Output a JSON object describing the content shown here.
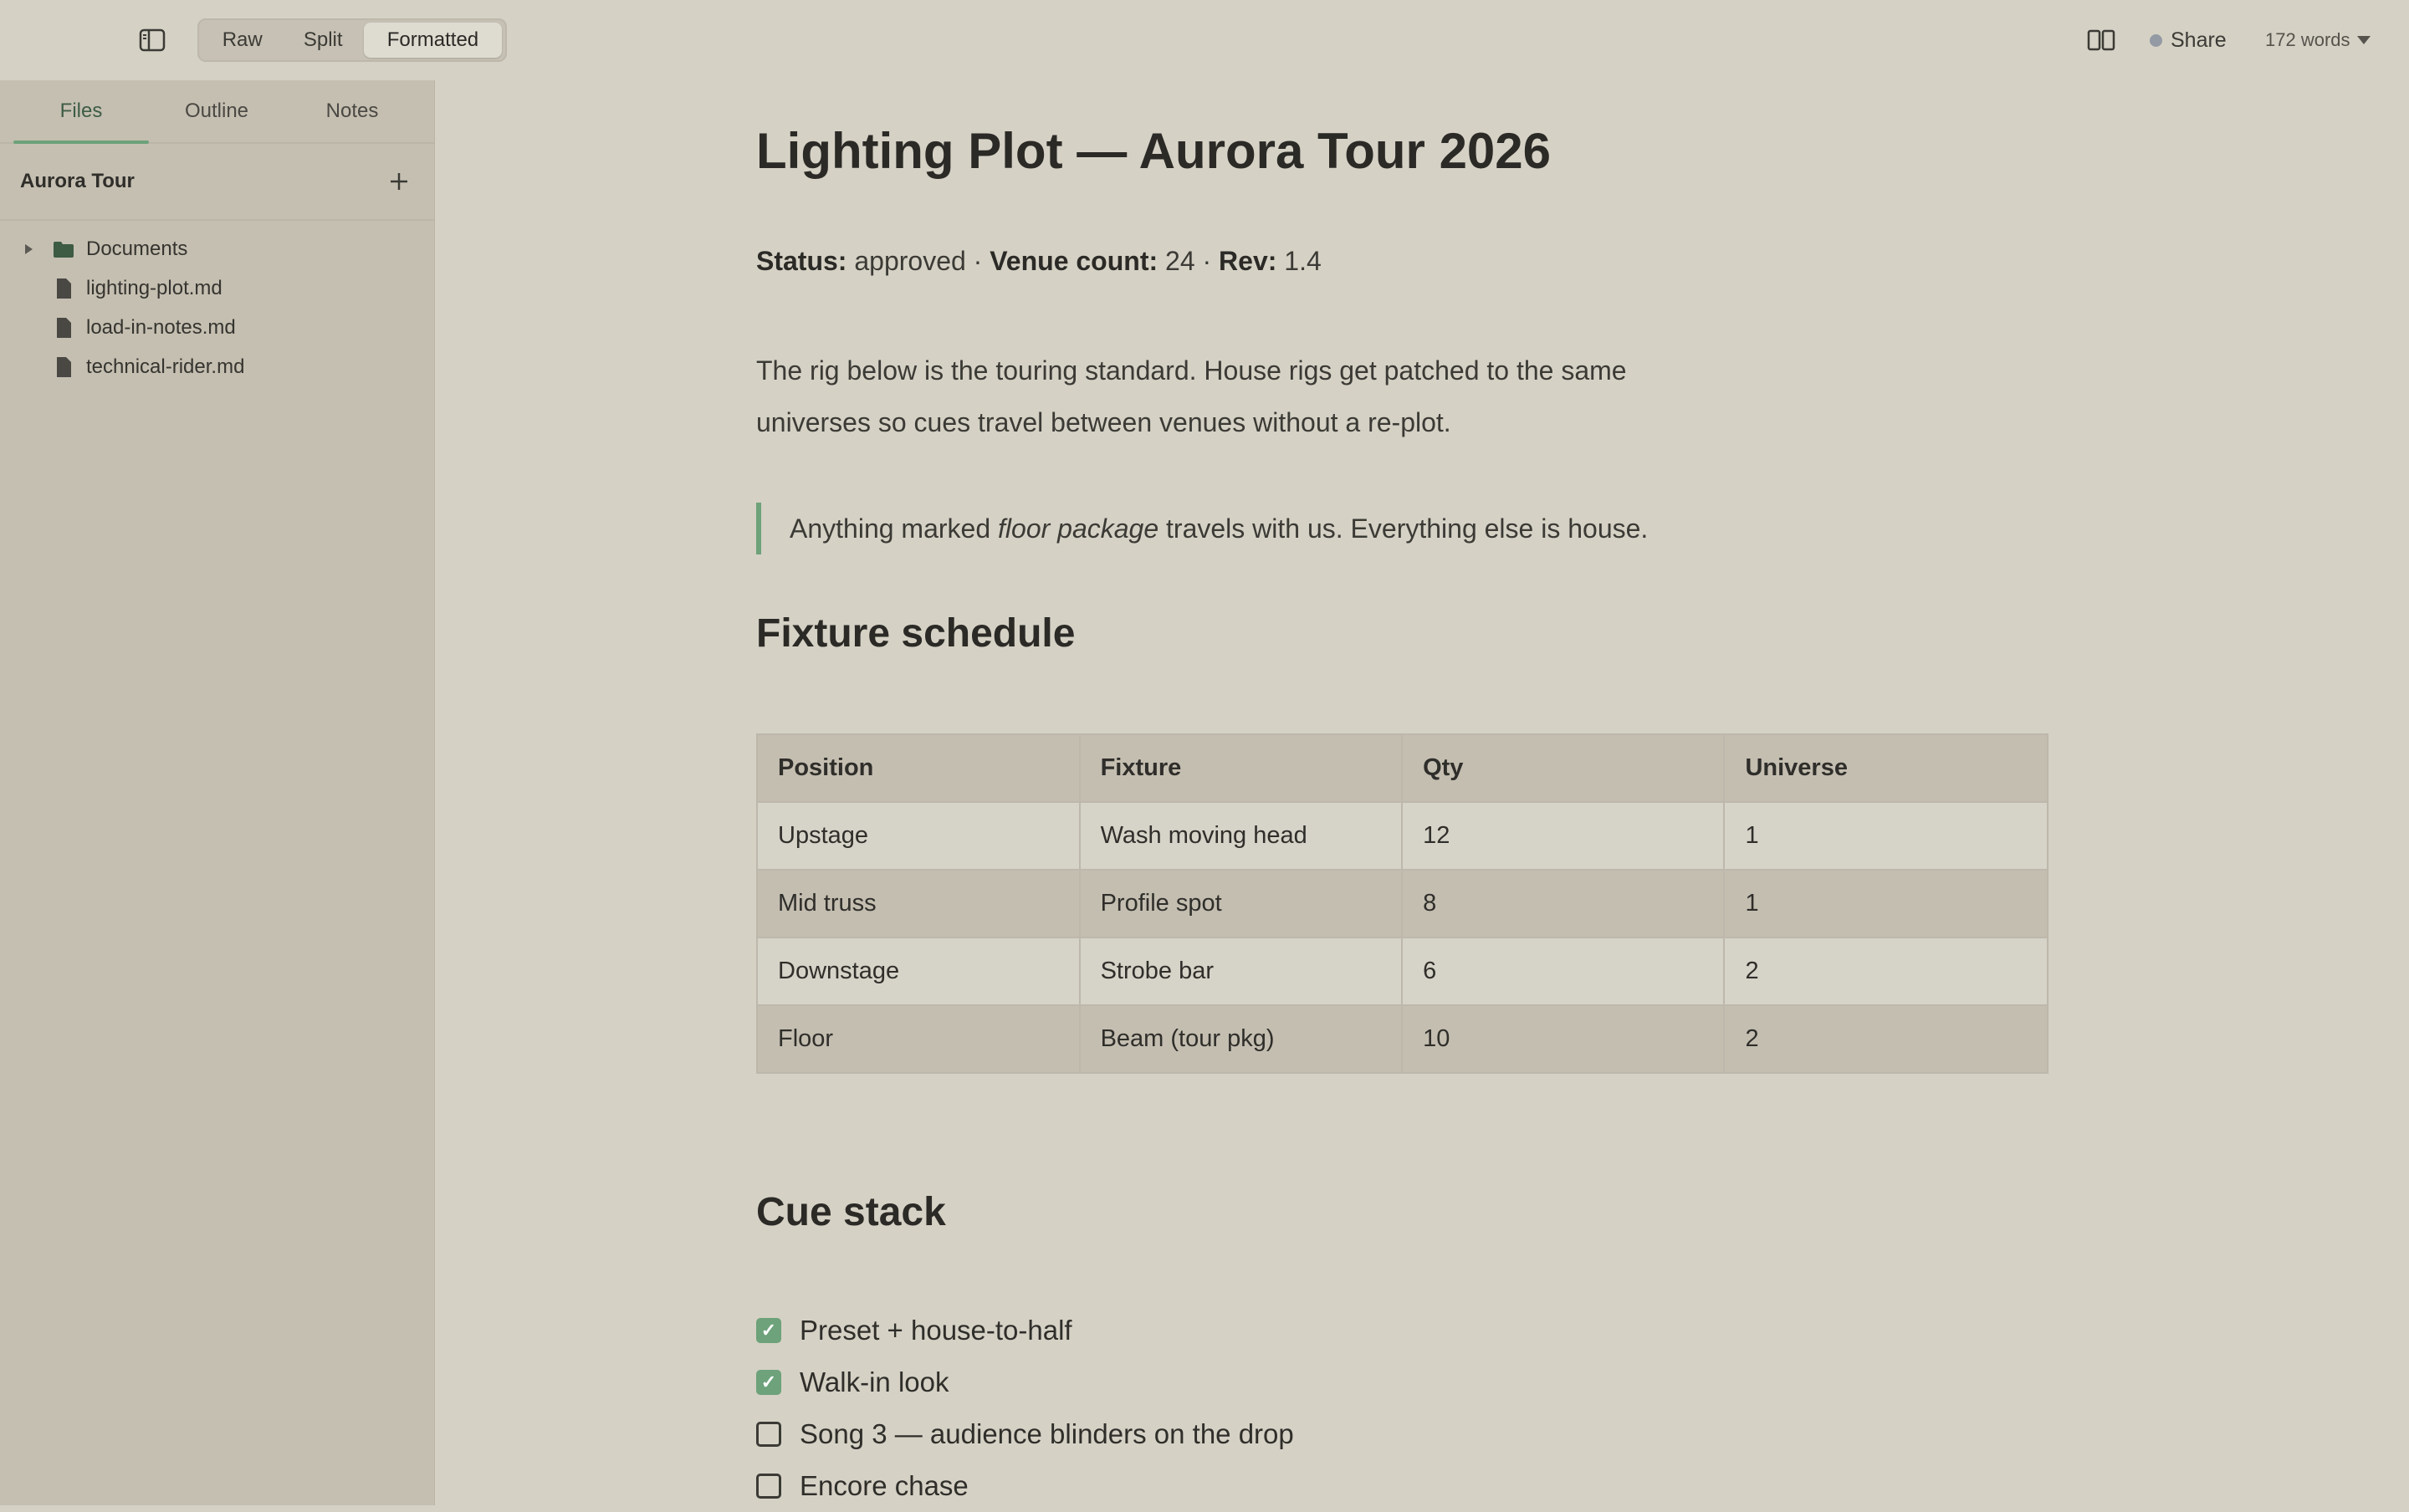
{
  "toolbar": {
    "modes": [
      "Raw",
      "Split",
      "Formatted"
    ],
    "active_mode": "Formatted",
    "share_label": "Share",
    "word_count": "172 words"
  },
  "sidebar": {
    "tabs": [
      "Files",
      "Outline",
      "Notes"
    ],
    "active_tab": "Files",
    "project": "Aurora Tour",
    "tree": [
      {
        "label": "Documents",
        "type": "folder"
      },
      {
        "label": "lighting-plot.md",
        "type": "file"
      },
      {
        "label": "load-in-notes.md",
        "type": "file"
      },
      {
        "label": "technical-rider.md",
        "type": "file"
      }
    ]
  },
  "document": {
    "title": "Lighting Plot — Aurora Tour 2026",
    "meta": {
      "status_label": "Status:",
      "status_value": "approved",
      "venue_label": "Venue count:",
      "venue_value": "24",
      "rev_label": "Rev:",
      "rev_value": "1.4",
      "sep": "·"
    },
    "paragraph": "The rig below is the touring standard. House rigs get patched to the same universes so cues travel between venues without a re-plot.",
    "quote": {
      "before": "Anything marked ",
      "em": "floor package",
      "after": " travels with us. Everything else is house."
    },
    "fixture_heading": "Fixture schedule",
    "table": {
      "headers": [
        "Position",
        "Fixture",
        "Qty",
        "Universe"
      ],
      "rows": [
        [
          "Upstage",
          "Wash moving head",
          "12",
          "1"
        ],
        [
          "Mid truss",
          "Profile spot",
          "8",
          "1"
        ],
        [
          "Downstage",
          "Strobe bar",
          "6",
          "2"
        ],
        [
          "Floor",
          "Beam (tour pkg)",
          "10",
          "2"
        ]
      ]
    },
    "cue_heading": "Cue stack",
    "tasks": [
      {
        "label": "Preset + house-to-half",
        "done": true
      },
      {
        "label": "Walk-in look",
        "done": true
      },
      {
        "label": "Song 3 — audience blinders on the drop",
        "done": false
      },
      {
        "label": "Encore chase",
        "done": false
      }
    ]
  },
  "colors": {
    "background": "#d5d1c5",
    "sidebar": "#c5bfb1",
    "accent": "#6da27a",
    "text": "#2b2a26"
  },
  "icons": {
    "sidebar_toggle": "sidebar-icon",
    "reader": "book-icon",
    "add": "plus-icon",
    "folder": "folder-icon",
    "file": "file-icon",
    "check": "check-icon"
  }
}
